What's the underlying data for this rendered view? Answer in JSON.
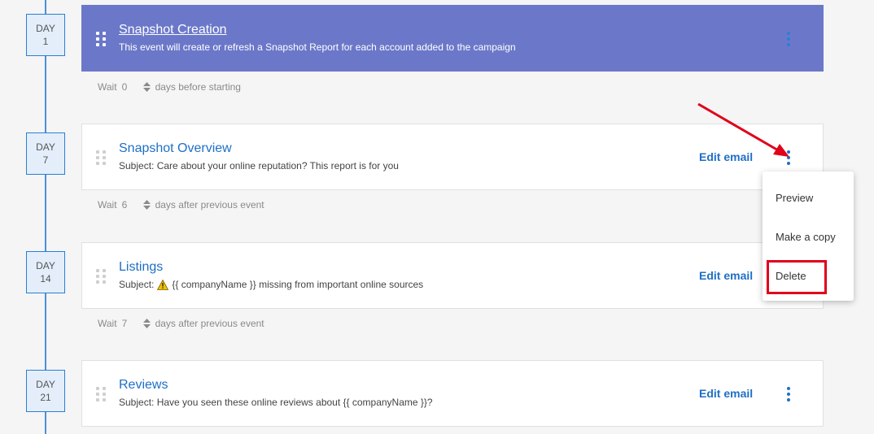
{
  "colors": {
    "accent": "#1f6fc5",
    "active_card": "#6b78c9",
    "timeline": "#4a90d9",
    "annotation": "#e0001a"
  },
  "events": [
    {
      "day_label": "DAY",
      "day_number": "1",
      "title": "Snapshot Creation",
      "subtitle": "This event will create or refresh a Snapshot Report for each account added to the campaign",
      "active": true,
      "wait": {
        "label": "Wait",
        "value": "0",
        "suffix": "days before starting"
      }
    },
    {
      "day_label": "DAY",
      "day_number": "7",
      "title": "Snapshot Overview",
      "subtitle": "Subject: Care about your online reputation? This report is for you",
      "edit_label": "Edit email",
      "wait": {
        "label": "Wait",
        "value": "6",
        "suffix": "days after previous event"
      }
    },
    {
      "day_label": "DAY",
      "day_number": "14",
      "title": "Listings",
      "subtitle_prefix": "Subject:",
      "subtitle_icon": "warning-icon",
      "subtitle": "{{ companyName }} missing from important online sources",
      "edit_label": "Edit email",
      "wait": {
        "label": "Wait",
        "value": "7",
        "suffix": "days after previous event"
      }
    },
    {
      "day_label": "DAY",
      "day_number": "21",
      "title": "Reviews",
      "subtitle": "Subject: Have you seen these online reviews about {{ companyName }}?",
      "edit_label": "Edit email"
    }
  ],
  "menu": {
    "items": [
      "Preview",
      "Make a copy",
      "Delete"
    ],
    "highlighted": "Delete"
  }
}
